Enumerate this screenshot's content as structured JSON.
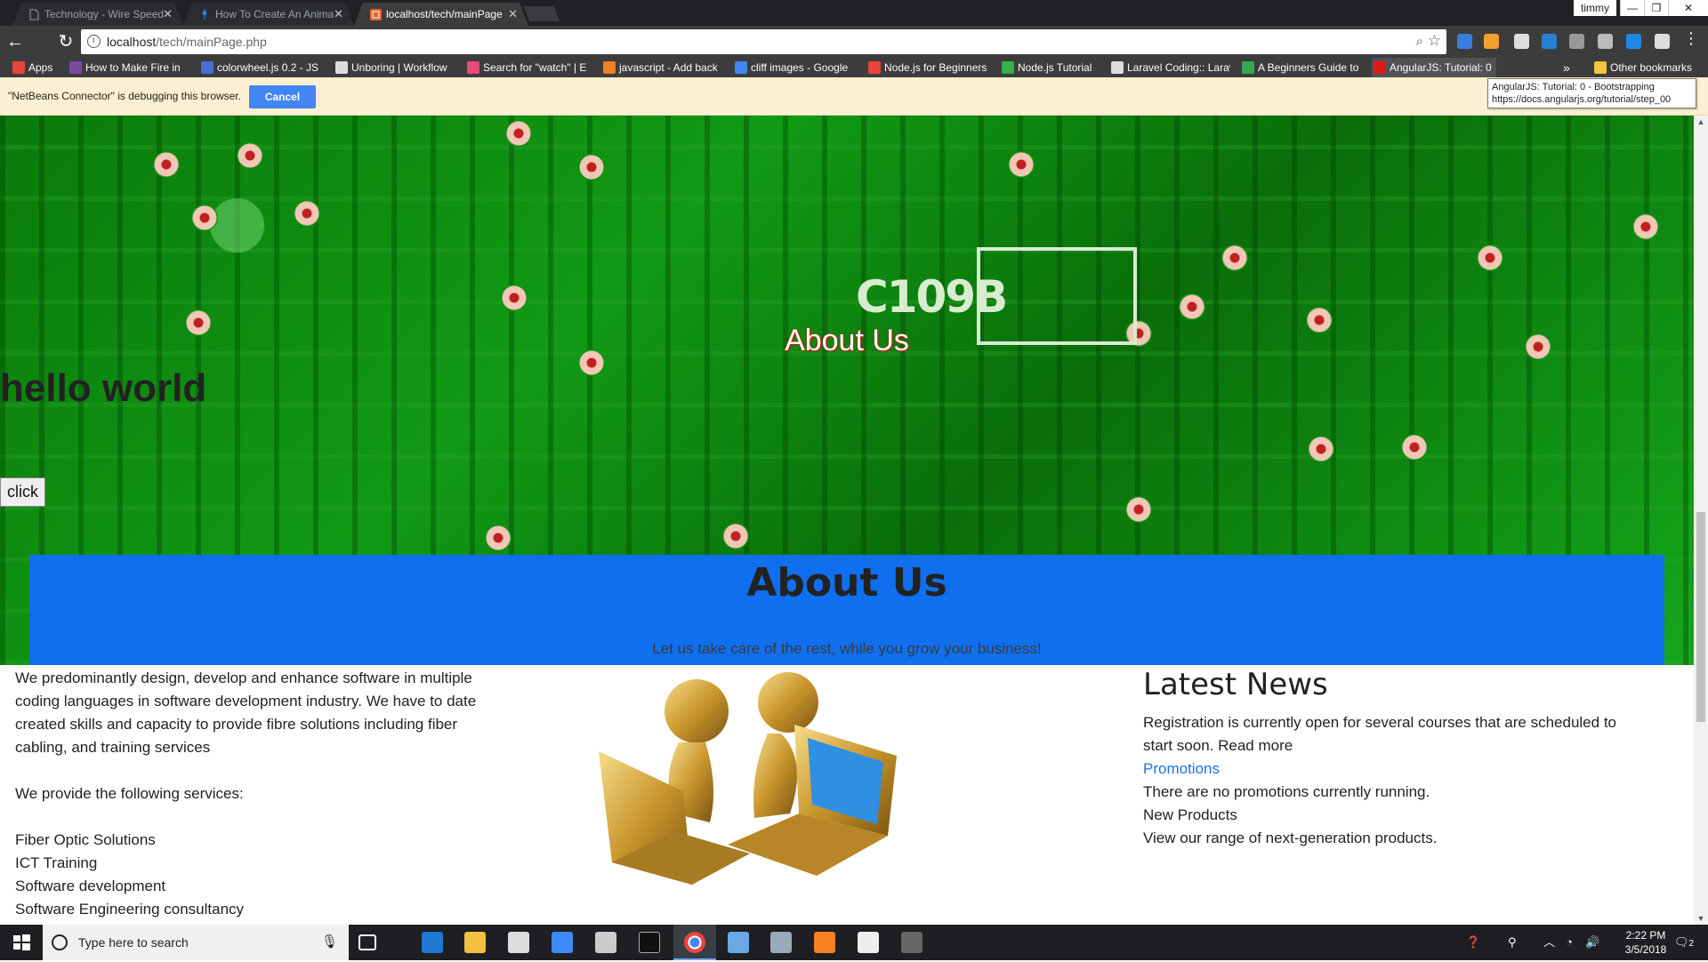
{
  "browser": {
    "tabs": [
      {
        "title": "Technology - Wire Speed",
        "active": false
      },
      {
        "title": "How To Create An Anima",
        "active": false
      },
      {
        "title": "localhost/tech/mainPage",
        "active": true
      }
    ],
    "profile_name": "timmy",
    "window_controls": {
      "minimize": "—",
      "maximize": "❐",
      "close": "✕"
    },
    "url_host": "localhost",
    "url_path": "/tech/mainPage.php",
    "bookmarks": [
      {
        "label": "Apps",
        "color": "#e8453c"
      },
      {
        "label": "How to Make Fire in",
        "color": "#7a4b9c"
      },
      {
        "label": "colorwheel.js 0.2 - JS",
        "color": "#4a6fd1"
      },
      {
        "label": "Unboring | Workflow",
        "color": "#dddddd"
      },
      {
        "label": "Search for \"watch\" | E",
        "color": "#e84a7a"
      },
      {
        "label": "javascript - Add back",
        "color": "#f48024"
      },
      {
        "label": "cliff images - Google",
        "color": "#4285f4"
      },
      {
        "label": "Node.js for Beginners",
        "color": "#e8453c"
      },
      {
        "label": "Node.js Tutorial",
        "color": "#33b24a"
      },
      {
        "label": "Laravel Coding:: Larav",
        "color": "#dddddd"
      },
      {
        "label": "A Beginners Guide to",
        "color": "#34a853"
      },
      {
        "label": "AngularJS: Tutorial: 0",
        "color": "#dd1b16"
      }
    ],
    "bookmarks_overflow": "»",
    "other_bookmarks": "Other bookmarks",
    "infobar_message": "\"NetBeans Connector\" is debugging this browser.",
    "infobar_cancel": "Cancel",
    "tooltip_line1": "AngularJS: Tutorial: 0 - Bootstrapping",
    "tooltip_line2": "https://docs.angularjs.org/tutorial/step_00"
  },
  "page": {
    "hero_title": "About Us",
    "hello_text": "hello world",
    "click_button": "click",
    "banner_title": "About Us",
    "banner_subtitle": "Let us take care of the rest, while you grow your business!",
    "about_paragraph": "We predominantly design, develop and enhance software in multiple coding languages in software development industry. We have to date created skills and capacity to provide fibre solutions including fiber cabling, and training services",
    "services_intro": "We provide the following services:",
    "services": [
      "Fiber Optic Solutions",
      "ICT Training",
      "Software development",
      "Software Engineering consultancy"
    ],
    "news_heading": "Latest News",
    "news_text": "Registration is currently open for several courses that are scheduled to start soon. Read more",
    "promotions_label": "Promotions",
    "promotions_text": "There are no promotions currently running.",
    "products_label": "New Products",
    "products_text": "View our range of next-generation products."
  },
  "taskbar": {
    "search_placeholder": "Type here to search",
    "time": "2:22 PM",
    "date": "3/5/2018",
    "notification_count": "2"
  },
  "colors": {
    "banner": "#0f6fef",
    "link": "#1a73e8",
    "infobar_button": "#4285f4"
  }
}
